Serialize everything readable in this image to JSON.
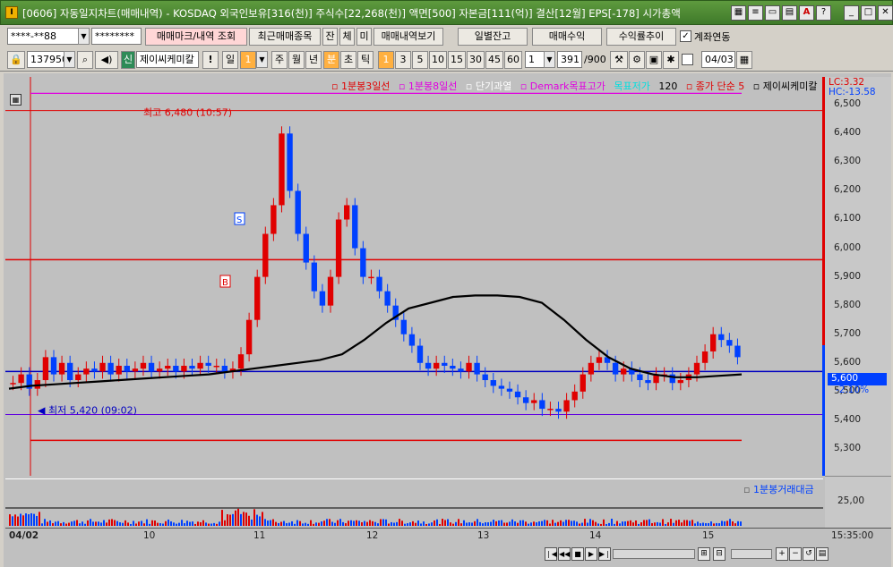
{
  "window": {
    "title": "[0606] 자동일지차트(매매내역) - KOSDAQ 외국인보유[316(천)] 주식수[22,268(천)] 액면[500] 자본금[111(억)] 결산[12월] EPS[-178] 시가총액"
  },
  "toolbar1": {
    "account": "****-**88",
    "password": "********",
    "buttons": [
      "매매마크/내역 조회",
      "최근매매종목",
      "잔",
      "체",
      "미",
      "매매내역보기"
    ],
    "right_buttons": [
      "일별잔고",
      "매매수익",
      "수익률추이"
    ],
    "link_label": "계좌연동",
    "link_checked": true
  },
  "toolbar2": {
    "stock_code": "137950",
    "new_badge": "신",
    "stock_name": "제이씨케미칼",
    "bang": "!",
    "period_label": "일",
    "period_value": "1",
    "periods": [
      "주",
      "월",
      "년"
    ],
    "min_label": "분",
    "periods2": [
      "초",
      "틱"
    ],
    "minutes": [
      "1",
      "3",
      "5",
      "10",
      "15",
      "30",
      "45",
      "60"
    ],
    "min_select": "1",
    "count": "391",
    "count_total": "/900",
    "date_value": "04/03",
    "date_checked": false
  },
  "legend": [
    {
      "text": "1분봉3일선",
      "color": "#e00000"
    },
    {
      "text": "1분봉8일선",
      "color": "#e000e0"
    },
    {
      "text": "단기과열",
      "color": "#ffffff"
    },
    {
      "text": "Demark목표고가",
      "color": "#e000e0"
    },
    {
      "text": "목표저가",
      "color": "#00e0e0"
    },
    {
      "text": "120",
      "color": "#000000"
    },
    {
      "text": "종가 단순 5",
      "color": "#e00000"
    },
    {
      "text": "제이씨케미칼",
      "color": "#000000"
    }
  ],
  "price_axis": {
    "ticks": [
      "6,500",
      "6,400",
      "6,300",
      "6,200",
      "6,100",
      "6,000",
      "5,900",
      "5,800",
      "5,700",
      "5,600",
      "5,500",
      "5,400",
      "5,300"
    ],
    "lc": "LC:3.32",
    "hc": "HC:-13.58",
    "current": "5,600",
    "change": "-2.10%"
  },
  "annotations": {
    "high": "최고 6,480 (10:57)",
    "low": "최저 5,420 (09:02)",
    "sell_mark": "S",
    "buy_mark": "B"
  },
  "volume": {
    "legend": "1분봉거래대금",
    "tick": "25,00"
  },
  "time_axis": {
    "labels": [
      "04/02",
      "10",
      "11",
      "12",
      "13",
      "14",
      "15"
    ],
    "clock": "15:35:00"
  },
  "chart_data": {
    "type": "candlestick",
    "ylim": [
      5250,
      6560
    ],
    "x": [
      "04/02",
      "10",
      "11",
      "12",
      "13",
      "14",
      "15"
    ],
    "close_series": [
      5530,
      5560,
      5510,
      5540,
      5620,
      5560,
      5600,
      5540,
      5560,
      5580,
      5570,
      5600,
      5560,
      5590,
      5570,
      5580,
      5600,
      5570,
      5580,
      5590,
      5570,
      5590,
      5580,
      5600,
      5590,
      5590,
      5570,
      5580,
      5630,
      5750,
      5900,
      6050,
      6150,
      6400,
      6200,
      6050,
      5950,
      5850,
      5800,
      5900,
      6100,
      6150,
      6000,
      5900,
      5900,
      5850,
      5800,
      5750,
      5700,
      5660,
      5600,
      5580,
      5600,
      5590,
      5580,
      5570,
      5600,
      5560,
      5540,
      5520,
      5510,
      5500,
      5480,
      5460,
      5470,
      5440,
      5440,
      5430,
      5470,
      5500,
      5560,
      5600,
      5620,
      5600,
      5560,
      5580,
      5560,
      5540,
      5530,
      5560,
      5560,
      5530,
      5540,
      5560,
      5600,
      5640,
      5700,
      5680,
      5660,
      5620
    ],
    "ma120": [
      5510,
      5520,
      5525,
      5530,
      5535,
      5540,
      5545,
      5550,
      5555,
      5560,
      5570,
      5580,
      5590,
      5600,
      5610,
      5630,
      5680,
      5740,
      5790,
      5810,
      5830,
      5835,
      5835,
      5830,
      5810,
      5750,
      5680,
      5620,
      5580,
      5560,
      5550,
      5550,
      5555,
      5560
    ],
    "reference_lines": {
      "high": 6480,
      "low": 5420,
      "demark_high": 5960,
      "demark_low": 5330,
      "blue": 5570,
      "upper_magenta": 6540
    }
  },
  "colors": {
    "up": "#e00000",
    "down": "#0040ff",
    "ma": "#000000",
    "bg": "#c0c0c0"
  }
}
